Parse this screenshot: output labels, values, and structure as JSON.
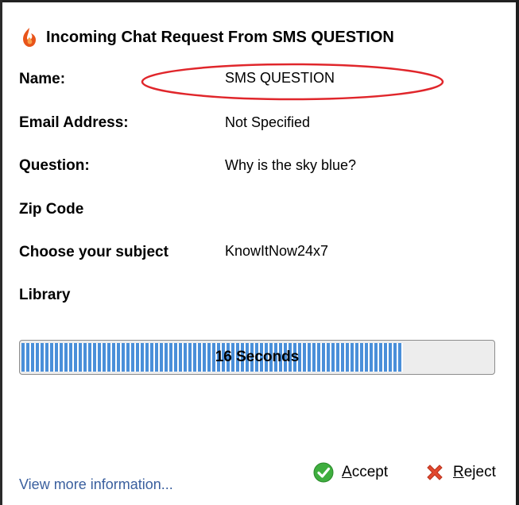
{
  "dialog": {
    "title": "Incoming Chat Request From SMS QUESTION"
  },
  "fields": [
    {
      "label": "Name:",
      "value": "SMS QUESTION"
    },
    {
      "label": "Email Address:",
      "value": "Not Specified"
    },
    {
      "label": "Question:",
      "value": "Why is the sky blue?"
    },
    {
      "label": "Zip Code",
      "value": ""
    },
    {
      "label": "Choose your subject",
      "value": "KnowItNow24x7"
    },
    {
      "label": "Library",
      "value": ""
    }
  ],
  "progress": {
    "label": "16 Seconds",
    "fraction": 0.81,
    "color": "#4a90d9"
  },
  "footer": {
    "more_link": "View more information...",
    "accept_label": "Accept",
    "reject_label": "Reject"
  },
  "icons": {
    "title": "flame-logo-icon",
    "accept": "green-check-icon",
    "reject": "red-x-icon"
  },
  "colors": {
    "highlight_ellipse": "#e0262b",
    "link": "#3a5f9e",
    "accept": "#3fae3f",
    "reject": "#e2492f",
    "logo": "#e8541a"
  }
}
